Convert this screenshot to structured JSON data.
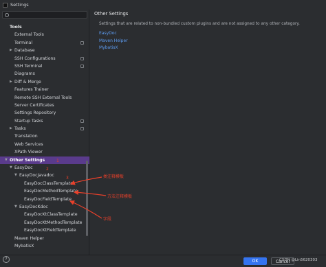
{
  "window": {
    "title": "Settings"
  },
  "search": {
    "value": ""
  },
  "tree": [
    {
      "label": "Tools",
      "indent": 0,
      "header": true
    },
    {
      "label": "External Tools",
      "indent": 1
    },
    {
      "label": "Terminal",
      "indent": 1,
      "marker": true
    },
    {
      "label": "Database",
      "indent": 1,
      "arrow": "right"
    },
    {
      "label": "SSH Configurations",
      "indent": 1,
      "marker": true
    },
    {
      "label": "SSH Terminal",
      "indent": 1,
      "marker": true
    },
    {
      "label": "Diagrams",
      "indent": 1
    },
    {
      "label": "Diff & Merge",
      "indent": 1,
      "arrow": "right"
    },
    {
      "label": "Features Trainer",
      "indent": 1
    },
    {
      "label": "Remote SSH External Tools",
      "indent": 1
    },
    {
      "label": "Server Certificates",
      "indent": 1
    },
    {
      "label": "Settings Repository",
      "indent": 1
    },
    {
      "label": "Startup Tasks",
      "indent": 1,
      "marker": true
    },
    {
      "label": "Tasks",
      "indent": 1,
      "arrow": "right",
      "marker": true
    },
    {
      "label": "Translation",
      "indent": 1
    },
    {
      "label": "Web Services",
      "indent": 1
    },
    {
      "label": "XPath Viewer",
      "indent": 1
    },
    {
      "label": "Other Settings",
      "indent": 0,
      "arrow": "down",
      "header": true,
      "selected": true
    },
    {
      "label": "EasyDoc",
      "indent": 1,
      "arrow": "down"
    },
    {
      "label": "EasyDocJavadoc",
      "indent": 2,
      "arrow": "down"
    },
    {
      "label": "EasyDocClassTemplate",
      "indent": 3
    },
    {
      "label": "EasyDocMethodTemplate",
      "indent": 3
    },
    {
      "label": "EasyDocFieldTemplate",
      "indent": 3
    },
    {
      "label": "EasyDocKdoc",
      "indent": 2,
      "arrow": "down"
    },
    {
      "label": "EasyDocKtClassTemplate",
      "indent": 3
    },
    {
      "label": "EasyDocKtMethodTemplate",
      "indent": 3
    },
    {
      "label": "EasyDocKtFieldTemplate",
      "indent": 3
    },
    {
      "label": "Maven Helper",
      "indent": 1
    },
    {
      "label": "MybatisX",
      "indent": 1
    }
  ],
  "panel": {
    "title": "Other Settings",
    "description": "Settings that are related to non-bundled custom plugins and are not assigned to any other category.",
    "links": [
      "EasyDoc",
      "Maven Helper",
      "MybatisX"
    ]
  },
  "buttons": {
    "ok": "OK",
    "cancel": "Cancel"
  },
  "help": {
    "glyph": "?"
  },
  "annotations": {
    "num1": "1",
    "num2": "2",
    "num3": "3",
    "label_class": "类注释模板",
    "label_method": "方法注释模板",
    "label_field": "字段"
  },
  "watermark": "CSDN @Lin5620303",
  "colors": {
    "accent": "#3574f0",
    "selection": "#5a3b8c",
    "link": "#5d9df3",
    "annotation": "#e8402a"
  },
  "icons": [
    "search-icon",
    "help-icon",
    "chevron-right-icon",
    "chevron-down-icon"
  ]
}
